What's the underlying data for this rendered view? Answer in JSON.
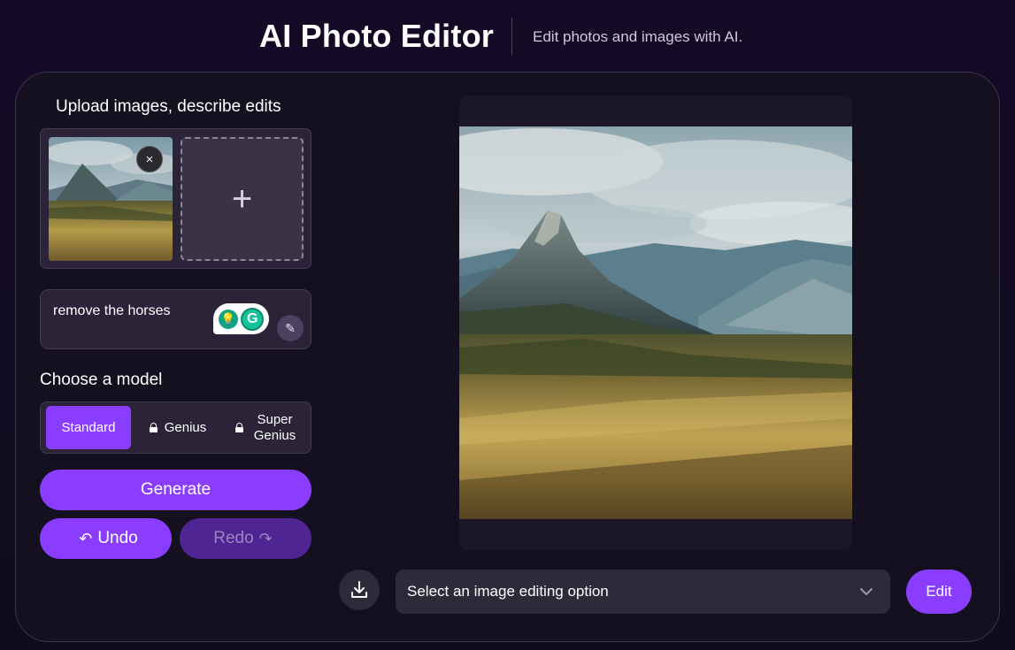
{
  "header": {
    "title": "AI Photo Editor",
    "subtitle": "Edit photos and images with AI."
  },
  "upload": {
    "heading": "Upload images, describe edits",
    "remove_label": "×",
    "add_label": "+"
  },
  "prompt": {
    "value": "remove the horses",
    "grammarly_g": "G"
  },
  "model": {
    "heading": "Choose a model",
    "options": [
      {
        "label": "Standard",
        "selected": true,
        "locked": false
      },
      {
        "label": "Genius",
        "selected": false,
        "locked": true
      },
      {
        "label": "Super Genius",
        "selected": false,
        "locked": true
      }
    ]
  },
  "actions": {
    "generate_label": "Generate",
    "undo_label": "Undo",
    "redo_label": "Redo"
  },
  "toolbar": {
    "select_value": "Select an image editing option",
    "edit_label": "Edit",
    "download_icon": "download-icon"
  },
  "colors": {
    "accent": "#8b3dff",
    "accent_disabled": "#4e2592",
    "panel": "#2b2439",
    "background": "#14101f"
  }
}
